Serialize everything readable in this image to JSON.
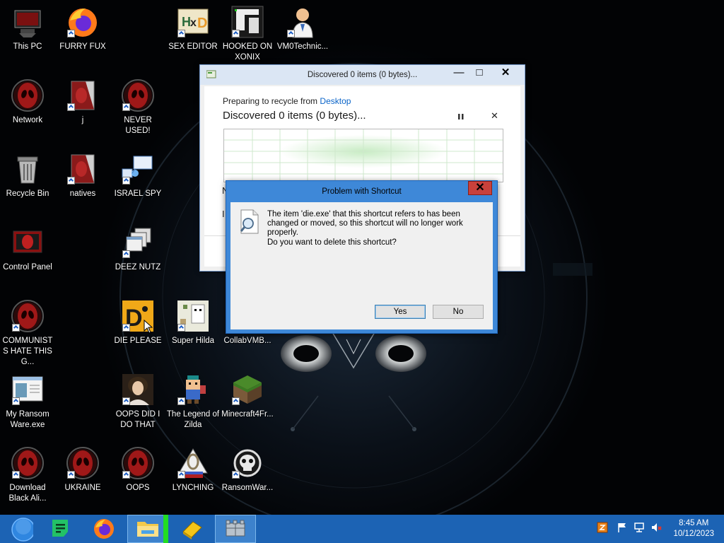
{
  "desktop_icons": [
    {
      "label": "This PC",
      "icon": "computer-icon"
    },
    {
      "label": "FURRY FUX",
      "icon": "firefox-icon"
    },
    {
      "label": "SEX EDITOR",
      "icon": "hxd-icon"
    },
    {
      "label": "HOOKED ON XONIX",
      "icon": "game-icon"
    },
    {
      "label": "VM0Technic...",
      "icon": "doctor-icon"
    },
    {
      "label": "Network",
      "icon": "alien-red-icon"
    },
    {
      "label": "j",
      "icon": "alien-tile-icon"
    },
    {
      "label": "NEVER USED!",
      "icon": "alien-red-icon"
    },
    {
      "label": "Recycle Bin",
      "icon": "recycle-bin-icon"
    },
    {
      "label": "natives",
      "icon": "alien-tile-icon"
    },
    {
      "label": "ISRAEL SPY",
      "icon": "network-spy-icon"
    },
    {
      "label": "Control Panel",
      "icon": "control-panel-icon"
    },
    {
      "label": "DEEZ NUTZ",
      "icon": "windows-stack-icon"
    },
    {
      "label": "COMMUNISTS HATE THIS G...",
      "icon": "alien-red-icon"
    },
    {
      "label": "DIE PLEASE",
      "icon": "die-icon"
    },
    {
      "label": "Super Hilda",
      "icon": "pixel-dog-icon"
    },
    {
      "label": "CollabVMB...",
      "icon": "blank-icon"
    },
    {
      "label": "My Ransom Ware.exe",
      "icon": "window-app-icon"
    },
    {
      "label": "OOPS DID I DO THAT",
      "icon": "portrait-icon"
    },
    {
      "label": "The Legend of Zilda",
      "icon": "pixel-hero-icon"
    },
    {
      "label": "Minecraft4Fr...",
      "icon": "grass-block-icon"
    },
    {
      "label": "Download Black Ali...",
      "icon": "alien-red-icon"
    },
    {
      "label": "UKRAINE",
      "icon": "alien-red-icon"
    },
    {
      "label": "OOPS",
      "icon": "alien-red-icon"
    },
    {
      "label": "LYNCHING",
      "icon": "noose-icon"
    },
    {
      "label": "RansomWar...",
      "icon": "skull-icon"
    }
  ],
  "progress_dialog": {
    "title": "Discovered 0 items (0 bytes)...",
    "preparing_prefix": "Preparing to recycle from",
    "location": "Desktop",
    "status": "Discovered 0 items (0 bytes)...",
    "obscured_text_1": "N",
    "obscured_text_2": "I",
    "minimize": "—",
    "maximize": "□",
    "close": "✕",
    "pause": "⏸",
    "cancel": "✕"
  },
  "error_dialog": {
    "title": "Problem with Shortcut",
    "close": "✕",
    "message": "The item 'die.exe' that this shortcut refers to has been changed or moved, so this shortcut will no longer work properly.",
    "question": "Do you want to delete this shortcut?",
    "yes_label": "Yes",
    "no_label": "No"
  },
  "taskbar": {
    "apps": [
      "start-orb-icon",
      "notepad-icon",
      "firefox-icon",
      "file-explorer-icon",
      "sticky-box-icon",
      "castle-icon"
    ],
    "active_app": "file-explorer-icon",
    "tray": [
      "ime-icon",
      "flag-icon",
      "network-icon",
      "volume-muted-icon"
    ],
    "time": "8:45 AM",
    "date": "10/12/2023"
  },
  "colors": {
    "taskbar": "#1c63b4",
    "dialog_frame": "#3e88d8",
    "close_red": "#c9413b",
    "link_blue": "#0a64c8"
  }
}
